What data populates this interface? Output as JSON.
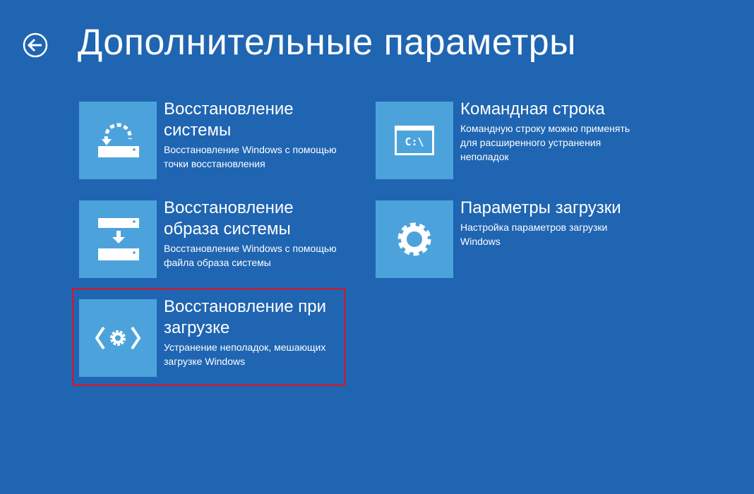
{
  "header": {
    "title": "Дополнительные параметры",
    "back_icon": "back-arrow-icon"
  },
  "options": [
    {
      "title": "Восстановление системы",
      "description": "Восстановление Windows с помощью точки восстановления",
      "icon": "system-restore-icon"
    },
    {
      "title": "Восстановление образа системы",
      "description": "Восстановление Windows с помощью файла образа системы",
      "icon": "system-image-icon"
    },
    {
      "title": "Восстановление при загрузке",
      "description": "Устранение неполадок, мешающих загрузке Windows",
      "icon": "startup-repair-icon",
      "selected": true
    },
    {
      "title": "Командная строка",
      "description": "Командную строку можно применять для расширенного устранения неполадок",
      "icon": "command-prompt-icon",
      "prompt": "C:\\"
    },
    {
      "title": "Параметры загрузки",
      "description": "Настройка параметров загрузки Windows",
      "icon": "gear-icon"
    }
  ],
  "colors": {
    "background": "#1f65b2",
    "tile": "#4ca3dc",
    "highlight": "#e8101a"
  }
}
